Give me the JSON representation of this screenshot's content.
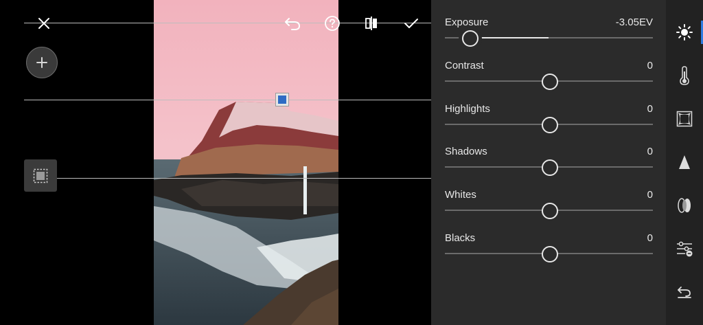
{
  "toolbar": {
    "close": "close-icon",
    "undo": "undo-icon",
    "help": "help-icon",
    "compare": "compare-icon",
    "done": "checkmark-icon"
  },
  "canvas": {
    "add_button": "plus-icon",
    "mask_button": "mask-selection-icon"
  },
  "adjustments": [
    {
      "label": "Exposure",
      "value": "-3.05EV",
      "level": 0.12,
      "active": true
    },
    {
      "label": "Contrast",
      "value": "0",
      "level": 0.5
    },
    {
      "label": "Highlights",
      "value": "0",
      "level": 0.5
    },
    {
      "label": "Shadows",
      "value": "0",
      "level": 0.5
    },
    {
      "label": "Whites",
      "value": "0",
      "level": 0.5
    },
    {
      "label": "Blacks",
      "value": "0",
      "level": 0.5
    }
  ],
  "tools": [
    {
      "name": "light",
      "icon": "sun-icon",
      "selected": true
    },
    {
      "name": "color",
      "icon": "thermometer-icon"
    },
    {
      "name": "effects",
      "icon": "vignette-icon"
    },
    {
      "name": "detail",
      "icon": "triangle-icon"
    },
    {
      "name": "optics",
      "icon": "lens-icon"
    },
    {
      "name": "settings",
      "icon": "sliders-icon"
    },
    {
      "name": "reset",
      "icon": "reset-icon"
    }
  ],
  "colors": {
    "accent": "#2f7de1",
    "panel": "#2b2b2b",
    "rail": "#222222",
    "sky": "#f0b7c1"
  }
}
